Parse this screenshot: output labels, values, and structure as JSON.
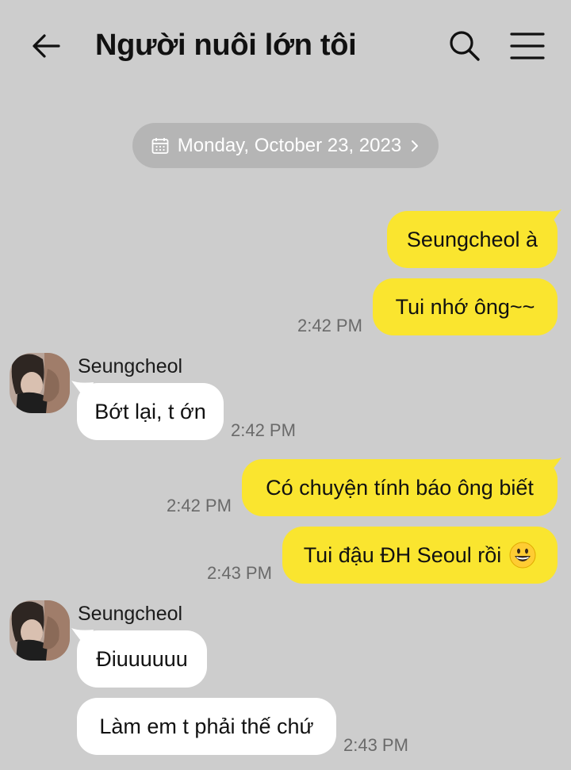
{
  "header": {
    "title": "Người nuôi lớn tôi",
    "back_icon": "arrow-left-icon",
    "search_icon": "search-icon",
    "menu_icon": "hamburger-menu-icon"
  },
  "date_pill": {
    "label": "Monday, October 23, 2023",
    "icon": "calendar-icon",
    "chevron": "chevron-right-icon"
  },
  "colors": {
    "background": "#cdcdcd",
    "outgoing_bubble": "#fae52f",
    "incoming_bubble": "#ffffff",
    "date_pill": "#b5b5b5",
    "timestamp": "#6a6a6a"
  },
  "messages": [
    {
      "direction": "out",
      "text": "Seungcheol à"
    },
    {
      "direction": "out",
      "text": "Tui nhớ ông~~",
      "time": "2:42 PM"
    },
    {
      "direction": "in",
      "sender": "Seungcheol",
      "text": "Bớt lại, t ớn",
      "time": "2:42 PM"
    },
    {
      "direction": "out",
      "text": "Có chuyện tính báo ông biết",
      "time": "2:42 PM"
    },
    {
      "direction": "out",
      "text": "Tui đậu ĐH Seoul rồi",
      "emoji": "grinning-face-emoji",
      "time": "2:43 PM"
    },
    {
      "direction": "in",
      "sender": "Seungcheol",
      "text": "Điuuuuuu"
    },
    {
      "direction": "in",
      "text": "Làm em t phải thế chứ",
      "time": "2:43 PM"
    }
  ]
}
